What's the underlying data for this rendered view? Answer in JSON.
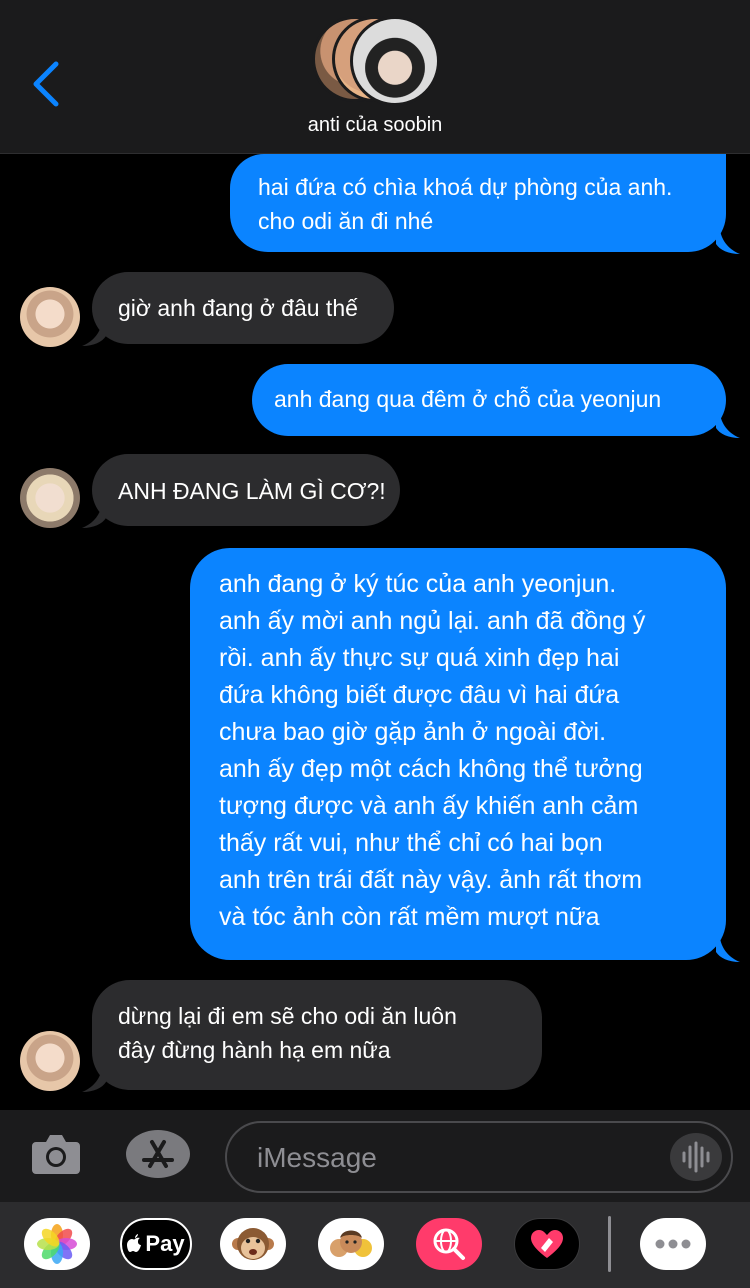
{
  "header": {
    "contact_name": "anti của soobin",
    "back_icon": "chevron-left-icon",
    "accent_color": "#0b84ff"
  },
  "messages": [
    {
      "direction": "outgoing",
      "lines": [
        "hai đứa có chìa khoá dự phòng của anh.",
        "cho odi ăn đi nhé"
      ]
    },
    {
      "direction": "incoming",
      "lines": [
        "giờ anh đang ở đâu thế"
      ]
    },
    {
      "direction": "outgoing",
      "lines": [
        "anh đang qua đêm ở chỗ của yeonjun"
      ]
    },
    {
      "direction": "incoming",
      "lines": [
        "ANH ĐANG LÀM GÌ CƠ?!"
      ]
    },
    {
      "direction": "outgoing",
      "lines": [
        "anh đang ở ký túc của anh yeonjun.",
        "anh ấy mời anh ngủ lại. anh đã đồng ý",
        "rồi. anh ấy thực sự quá xinh đẹp hai",
        "đứa không biết được đâu vì hai đứa",
        "chưa bao giờ gặp ảnh ở ngoài đời.",
        "anh ấy đẹp một cách không thể tưởng",
        "tượng được và anh ấy khiến anh cảm",
        "thấy rất vui, như thể chỉ có hai bọn",
        "anh trên trái đất này vậy. ảnh rất thơm",
        "và tóc ảnh còn rất mềm mượt nữa"
      ]
    },
    {
      "direction": "incoming",
      "lines": [
        "dừng lại đi em sẽ cho odi ăn luôn",
        "đây đừng hành hạ em nữa"
      ]
    }
  ],
  "input": {
    "placeholder": "iMessage",
    "camera_icon": "camera-icon",
    "appstore_icon": "app-store-icon",
    "audio_icon": "audio-waveform-icon"
  },
  "app_strip": {
    "items": [
      {
        "name": "photos-app",
        "icon": "photos-icon"
      },
      {
        "name": "apple-pay",
        "label": "Pay",
        "icon": "apple-logo-icon"
      },
      {
        "name": "animoji",
        "icon": "monkey-icon"
      },
      {
        "name": "memoji",
        "icon": "memoji-stickers-icon"
      },
      {
        "name": "web-search",
        "icon": "globe-search-icon"
      },
      {
        "name": "digital-touch",
        "icon": "heart-touch-icon"
      },
      {
        "name": "more-apps",
        "icon": "more-icon"
      }
    ]
  },
  "colors": {
    "outgoing_bubble": "#0b84ff",
    "incoming_bubble": "#2c2c2e",
    "background": "#000000"
  }
}
